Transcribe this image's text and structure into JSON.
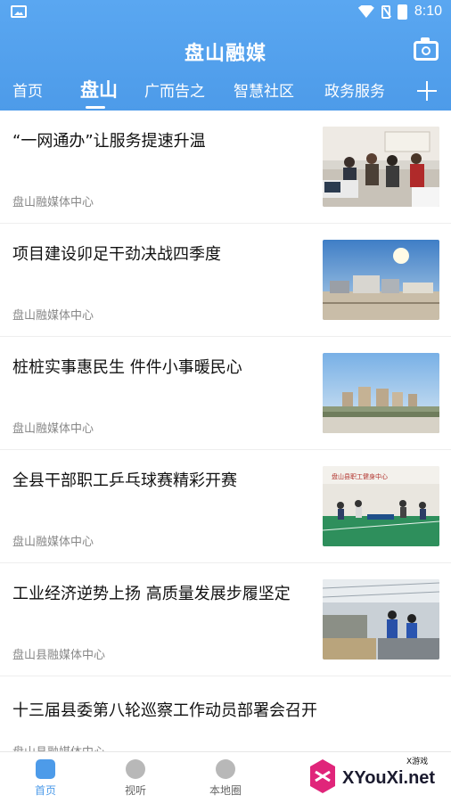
{
  "status": {
    "time": "8:10"
  },
  "header": {
    "title": "盘山融媒"
  },
  "tabs": [
    "首页",
    "盘山",
    "广而告之",
    "智慧社区",
    "政务服务"
  ],
  "news": [
    {
      "title": "“一网通办”让服务提速升温",
      "source": "盘山融媒体中心"
    },
    {
      "title": "项目建设卯足干劲决战四季度",
      "source": "盘山融媒体中心"
    },
    {
      "title": "桩桩实事惠民生 件件小事暖民心",
      "source": "盘山融媒体中心"
    },
    {
      "title": "全县干部职工乒乓球赛精彩开赛",
      "source": "盘山融媒体中心"
    },
    {
      "title": "工业经济逆势上扬 高质量发展步履坚定",
      "source": "盘山县融媒体中心"
    },
    {
      "title": "十三届县委第八轮巡察工作动员部署会召开",
      "source": "盘山县融媒体中心"
    }
  ],
  "thumb_text": {
    "gym_banner": "盘山县职工健身中心"
  },
  "bottom_nav": [
    "首页",
    "视听",
    "本地圈"
  ],
  "watermark": {
    "top": "X游戏",
    "main": "XYouXi.net"
  },
  "colors": {
    "primary": "#4d9be9"
  }
}
